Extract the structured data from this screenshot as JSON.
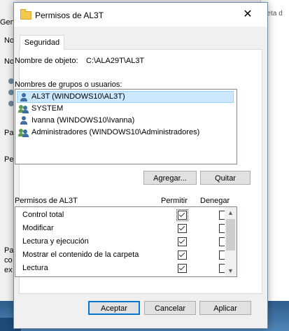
{
  "background": {
    "right_fragment": "peta d",
    "left_fragments": [
      "Gen",
      "No",
      "No",
      "Pa",
      "Pe",
      "Pa",
      "co",
      "ex"
    ]
  },
  "dialog": {
    "title": "Permisos de AL3T",
    "close_glyph": "✕",
    "tab_label": "Seguridad",
    "object_name_label": "Nombre de objeto:",
    "object_name_value": "C:\\ALA29T\\AL3T",
    "groups_label": "Nombres de grupos o usuarios:",
    "groups": [
      {
        "name": "AL3T (WINDOWS10\\AL3T)",
        "icon": "single-user-icon",
        "selected": true
      },
      {
        "name": "SYSTEM",
        "icon": "user-group-icon",
        "selected": false
      },
      {
        "name": "Ivanna (WINDOWS10\\Ivanna)",
        "icon": "single-user-icon",
        "selected": false
      },
      {
        "name": "Administradores (WINDOWS10\\Administradores)",
        "icon": "user-group-icon",
        "selected": false
      }
    ],
    "add_button": "Agregar...",
    "remove_button": "Quitar",
    "permissions_header": "Permisos de AL3T",
    "allow_header": "Permitir",
    "deny_header": "Denegar",
    "permissions": [
      {
        "name": "Control total",
        "allow": true,
        "deny": false
      },
      {
        "name": "Modificar",
        "allow": true,
        "deny": false
      },
      {
        "name": "Lectura y ejecución",
        "allow": true,
        "deny": false
      },
      {
        "name": "Mostrar el contenido de la carpeta",
        "allow": true,
        "deny": false
      },
      {
        "name": "Lectura",
        "allow": true,
        "deny": false
      }
    ],
    "scroll_up": "▲",
    "scroll_down": "▼",
    "accept_button": "Aceptar",
    "cancel_button": "Cancelar",
    "apply_button": "Aplicar"
  },
  "colors": {
    "selection": "#cce8ff",
    "accent_border": "#0078d7",
    "user_icon_blue": "#3b6ea5",
    "group_icon_green": "#5e9c4e"
  }
}
